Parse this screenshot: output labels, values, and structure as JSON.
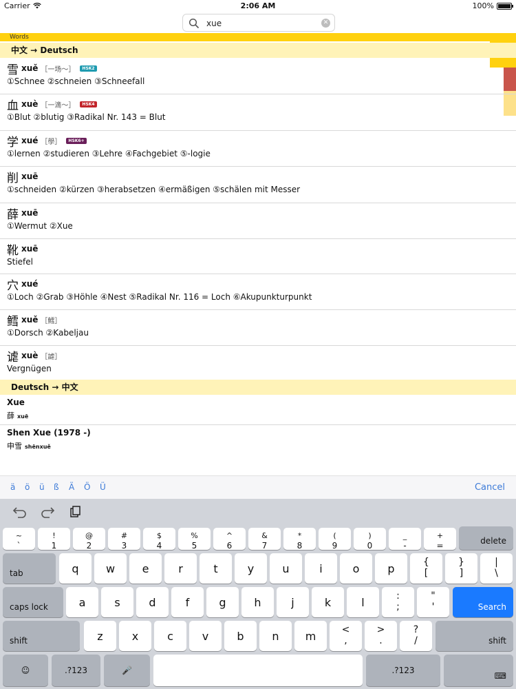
{
  "status": {
    "carrier": "Carrier",
    "time": "2:06 AM",
    "battery": "100%"
  },
  "search": {
    "value": "xue"
  },
  "words_label": "Words",
  "sections": {
    "zh_de": "中文 → Deutsch",
    "de_zh": "Deutsch → 中文"
  },
  "zh_entries": [
    {
      "han": "雪",
      "pinyin": "xuě",
      "example": "［一场～］",
      "hsk": "HSK2",
      "hsk_color": "#1f9bb0",
      "meaning": "①Schnee ②schneien ③Schneefall"
    },
    {
      "han": "血",
      "pinyin": "xuè",
      "example": "［一滴～］",
      "hsk": "HSK4",
      "hsk_color": "#c2252b",
      "meaning": "①Blut ②blutig ③Radikal Nr. 143 = Blut"
    },
    {
      "han": "学",
      "pinyin": "xué",
      "example": "［學］",
      "hsk": "HSK6+",
      "hsk_color": "#6a1f5a",
      "meaning": "①lernen ②studieren ③Lehre ④Fachgebiet ⑤-logie"
    },
    {
      "han": "削",
      "pinyin": "xuē",
      "example": "",
      "hsk": "",
      "hsk_color": "",
      "meaning": "①schneiden ②kürzen ③herabsetzen ④ermäßigen ⑤schälen mit Messer"
    },
    {
      "han": "薛",
      "pinyin": "xuē",
      "example": "",
      "hsk": "",
      "hsk_color": "",
      "meaning": "①Wermut ②Xue"
    },
    {
      "han": "靴",
      "pinyin": "xuē",
      "example": "",
      "hsk": "",
      "hsk_color": "",
      "meaning": "Stiefel"
    },
    {
      "han": "穴",
      "pinyin": "xué",
      "example": "",
      "hsk": "",
      "hsk_color": "",
      "meaning": "①Loch ②Grab ③Höhle ④Nest ⑤Radikal Nr. 116 = Loch ⑥Akupunkturpunkt"
    },
    {
      "han": "鳕",
      "pinyin": "xuě",
      "example": "［鱈］",
      "hsk": "",
      "hsk_color": "",
      "meaning": "①Dorsch ②Kabeljau"
    },
    {
      "han": "谑",
      "pinyin": "xuè",
      "example": "［謔］",
      "hsk": "",
      "hsk_color": "",
      "meaning": "Vergnügen"
    }
  ],
  "de_entries": [
    {
      "word": "Xue",
      "han": "薛",
      "pinyin": "xuē"
    },
    {
      "word": "Shen Xue (1978 -)",
      "han": "申雪",
      "pinyin": "shēnxuě"
    }
  ],
  "accent_keys": [
    "ä",
    "ö",
    "ü",
    "ß",
    "Ä",
    "Ö",
    "Ü"
  ],
  "cancel_label": "Cancel",
  "keyboard": {
    "row1": [
      {
        "top": "~",
        "bot": "`"
      },
      {
        "top": "!",
        "bot": "1"
      },
      {
        "top": "@",
        "bot": "2"
      },
      {
        "top": "#",
        "bot": "3"
      },
      {
        "top": "$",
        "bot": "4"
      },
      {
        "top": "%",
        "bot": "5"
      },
      {
        "top": "^",
        "bot": "6"
      },
      {
        "top": "&",
        "bot": "7"
      },
      {
        "top": "*",
        "bot": "8"
      },
      {
        "top": "(",
        "bot": "9"
      },
      {
        "top": ")",
        "bot": "0"
      },
      {
        "top": "_",
        "bot": "-"
      },
      {
        "top": "+",
        "bot": "="
      }
    ],
    "delete": "delete",
    "tab": "tab",
    "row2": [
      "q",
      "w",
      "e",
      "r",
      "t",
      "y",
      "u",
      "i",
      "o",
      "p"
    ],
    "row2_punct": [
      {
        "top": "{",
        "bot": "["
      },
      {
        "top": "}",
        "bot": "]"
      },
      {
        "top": "|",
        "bot": "\\"
      }
    ],
    "caps": "caps lock",
    "row3": [
      "a",
      "s",
      "d",
      "f",
      "g",
      "h",
      "j",
      "k",
      "l"
    ],
    "row3_punct": [
      {
        "top": ":",
        "bot": ";"
      },
      {
        "top": "\"",
        "bot": "'"
      }
    ],
    "search": "Search",
    "shift": "shift",
    "row4": [
      "z",
      "x",
      "c",
      "v",
      "b",
      "n",
      "m"
    ],
    "row4_punct": [
      {
        "top": "<",
        "bot": ","
      },
      {
        "top": ">",
        "bot": "."
      },
      {
        "top": "?",
        "bot": "/"
      }
    ],
    "numbers": ".?123",
    "emoji": "☺",
    "mic": "🎤",
    "hide": "⌨"
  }
}
